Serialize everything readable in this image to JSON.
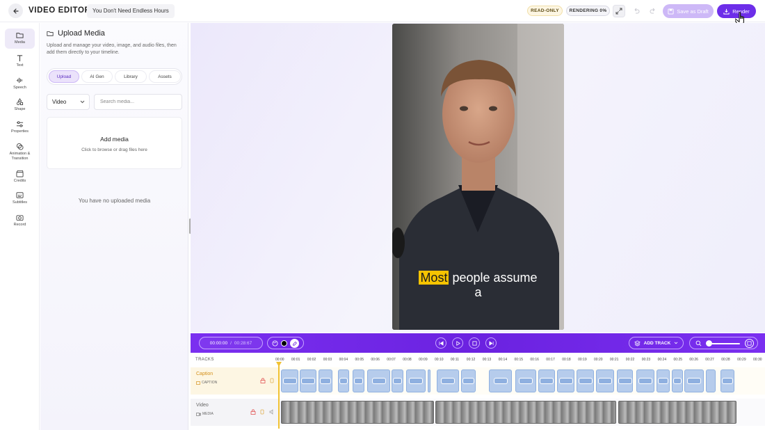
{
  "header": {
    "app_title": "VIDEO EDITOR",
    "project_title": "You Don't Need Endless Hours",
    "badge_readonly": "READ-ONLY",
    "badge_rendering": "RENDERING 0%",
    "save_label": "Save as Draft",
    "render_label": "Render"
  },
  "sidebar": {
    "items": [
      {
        "label": "Media"
      },
      {
        "label": "Text"
      },
      {
        "label": "Speech"
      },
      {
        "label": "Shape"
      },
      {
        "label": "Properties"
      },
      {
        "label": "Animation & Transition"
      },
      {
        "label": "Credits"
      },
      {
        "label": "Subtitles"
      },
      {
        "label": "Record"
      }
    ]
  },
  "panel": {
    "title": "Upload Media",
    "description": "Upload and manage your video, image, and audio files, then add them directly to your timeline.",
    "tabs": [
      "Upload",
      "AI Gen",
      "Library",
      "Assets"
    ],
    "type_select": "Video",
    "search_placeholder": "Search media...",
    "dropzone_title": "Add media",
    "dropzone_sub": "Click to browse or drag files here",
    "empty_text": "You have no uploaded media"
  },
  "preview": {
    "caption_highlight": "Most",
    "caption_rest": " people assume",
    "caption_line2": "a"
  },
  "toolbar": {
    "current_time": "00:00:00",
    "duration": "00:28:67",
    "add_track_label": "ADD TRACK"
  },
  "timeline": {
    "label": "TRACKS",
    "ticks": [
      "00:00",
      "00:01",
      "00:02",
      "00:03",
      "00:04",
      "00:05",
      "00:06",
      "00:07",
      "00:08",
      "00:09",
      "00:10",
      "00:11",
      "00:12",
      "00:13",
      "00:14",
      "00:15",
      "00:16",
      "00:17",
      "00:18",
      "00:19",
      "00:20",
      "00:21",
      "00:22",
      "00:23",
      "00:24",
      "00:25",
      "00:26",
      "00:27",
      "00:28",
      "00:29",
      "00:30"
    ],
    "tracks": [
      {
        "name": "Caption",
        "type": "CAPTION"
      },
      {
        "name": "Video",
        "type": "MEDIA"
      }
    ]
  },
  "colors": {
    "accent": "#6d2ee9",
    "caption_highlight": "#f6c400",
    "playhead": "#f1c232"
  }
}
